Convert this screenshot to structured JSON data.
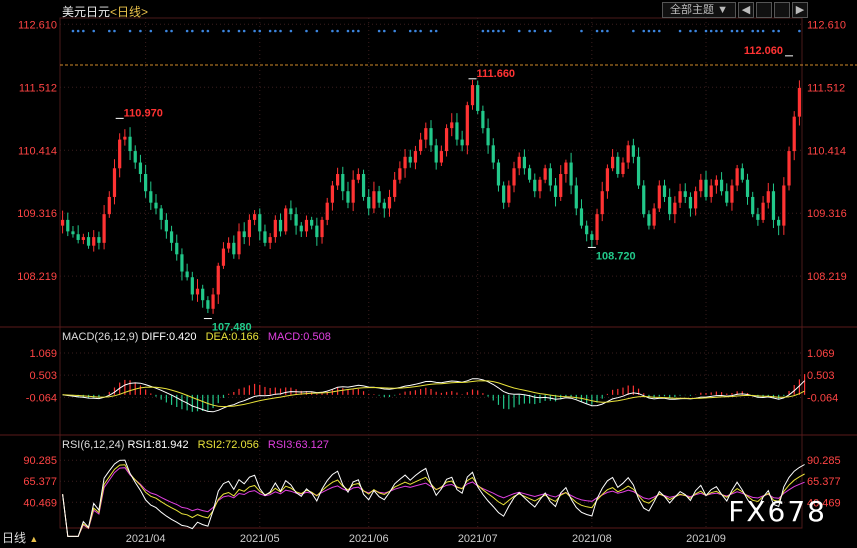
{
  "header": {
    "instrument": "美元日元",
    "period_tag": "<日线>",
    "theme_label": "全部主题",
    "theme_arrow": "▼",
    "btn_prev": "◀",
    "btn_next": "▶"
  },
  "footer": {
    "period_tab": "日线",
    "period_tab_arrow": "▲",
    "brand": "FX678"
  },
  "colors": {
    "up": "#ff3333",
    "down": "#22c88a",
    "diff": "#ffffff",
    "dea": "#e8e23a",
    "rsi1": "#ffffff",
    "rsi2": "#e8e23a",
    "rsi3": "#e040e0",
    "axis_red": "#ff4444",
    "grid": "#3a1e1e",
    "dots": "#3c86e0",
    "refline": "#d08a2a"
  },
  "chart_data": [
    {
      "type": "candlestick",
      "title": "美元日元<日线>",
      "y_ticks": [
        112.61,
        111.512,
        110.414,
        109.316,
        108.219
      ],
      "y_tick_labels": [
        "112.610",
        "111.512",
        "110.414",
        "109.316",
        "108.219"
      ],
      "ylim": [
        107.35,
        112.72
      ],
      "x_tick_labels": [
        "2021/04",
        "2021/05",
        "2021/06",
        "2021/07",
        "2021/08",
        "2021/09"
      ],
      "x_tick_index": [
        16,
        38,
        59,
        80,
        102,
        124
      ],
      "n_bars": 143,
      "annotations": [
        {
          "label": "110.970",
          "index": 11,
          "value": 110.97,
          "kind": "high"
        },
        {
          "label": "107.480",
          "index": 28,
          "value": 107.48,
          "kind": "low"
        },
        {
          "label": "111.660",
          "index": 79,
          "value": 111.66,
          "kind": "high"
        },
        {
          "label": "108.720",
          "index": 102,
          "value": 108.72,
          "kind": "low"
        },
        {
          "label": "112.060",
          "index": 140,
          "value": 112.06,
          "kind": "high"
        }
      ],
      "reference_line": 111.9,
      "closes": [
        109.2,
        109.0,
        108.95,
        108.85,
        108.9,
        108.75,
        108.9,
        108.8,
        109.3,
        109.6,
        110.1,
        110.6,
        110.65,
        110.4,
        110.2,
        110.0,
        109.7,
        109.5,
        109.4,
        109.2,
        109.0,
        108.8,
        108.6,
        108.3,
        108.2,
        107.9,
        108.0,
        107.8,
        107.65,
        107.9,
        108.4,
        108.7,
        108.8,
        108.6,
        109.0,
        108.9,
        109.2,
        109.3,
        109.0,
        108.8,
        108.9,
        109.2,
        109.0,
        109.4,
        109.3,
        109.1,
        109.0,
        109.2,
        109.1,
        108.9,
        109.2,
        109.5,
        109.8,
        110.0,
        109.7,
        109.5,
        109.9,
        110.0,
        109.6,
        109.4,
        109.7,
        109.5,
        109.4,
        109.6,
        109.9,
        110.1,
        110.3,
        110.2,
        110.4,
        110.6,
        110.8,
        110.5,
        110.2,
        110.4,
        110.8,
        110.9,
        110.6,
        110.5,
        111.2,
        111.55,
        111.1,
        110.8,
        110.5,
        110.2,
        109.8,
        109.5,
        109.8,
        110.1,
        110.3,
        110.1,
        109.9,
        109.7,
        109.9,
        110.1,
        109.8,
        109.6,
        110.0,
        110.2,
        109.8,
        109.4,
        109.1,
        108.95,
        108.85,
        109.3,
        109.7,
        110.1,
        110.3,
        110.0,
        110.2,
        110.5,
        110.3,
        109.8,
        109.3,
        109.1,
        109.4,
        109.8,
        109.6,
        109.3,
        109.5,
        109.7,
        109.6,
        109.4,
        109.7,
        109.9,
        109.6,
        109.8,
        109.9,
        109.7,
        109.5,
        109.8,
        110.1,
        109.9,
        109.6,
        109.3,
        109.2,
        109.5,
        109.7,
        109.2,
        109.1,
        109.8,
        110.4,
        111.0,
        111.5,
        112.0
      ]
    },
    {
      "type": "line",
      "title": "MACD(26,12,9)",
      "series": [
        {
          "name": "DIFF",
          "value_label": "DIFF:0.420"
        },
        {
          "name": "DEA",
          "value_label": "DEA:0.166"
        },
        {
          "name": "MACD",
          "value_label": "MACD:0.508",
          "type": "bar"
        }
      ],
      "y_ticks": [
        1.069,
        0.503,
        -0.064
      ],
      "y_tick_labels": [
        "1.069",
        "0.503",
        "-0.064"
      ],
      "ylim": [
        -0.95,
        1.3
      ]
    },
    {
      "type": "line",
      "title": "RSI(6,12,24)",
      "series": [
        {
          "name": "RSI1",
          "value_label": "RSI1:81.942"
        },
        {
          "name": "RSI2",
          "value_label": "RSI2:72.056"
        },
        {
          "name": "RSI3",
          "value_label": "RSI3:63.127"
        }
      ],
      "y_ticks": [
        90.285,
        65.377,
        40.469
      ],
      "y_tick_labels": [
        "90.285",
        "65.377",
        "40.469"
      ],
      "ylim": [
        10,
        100
      ]
    }
  ]
}
